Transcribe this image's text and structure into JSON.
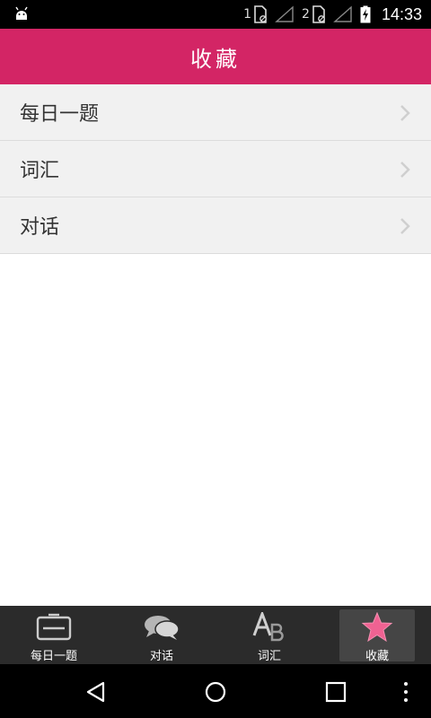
{
  "status_bar": {
    "sim1": "1",
    "sim2": "2",
    "time": "14:33"
  },
  "header": {
    "title": "收藏"
  },
  "favorites": [
    {
      "label": "每日一题"
    },
    {
      "label": "词汇"
    },
    {
      "label": "对话"
    }
  ],
  "tabs": [
    {
      "label": "每日一题",
      "icon": "daily-card-icon",
      "active": false
    },
    {
      "label": "对话",
      "icon": "chat-bubbles-icon",
      "active": false
    },
    {
      "label": "词汇",
      "icon": "ab-letters-icon",
      "active": false
    },
    {
      "label": "收藏",
      "icon": "star-icon",
      "active": true
    }
  ],
  "colors": {
    "accent": "#d32565",
    "list_bg": "#f1f1f1",
    "tab_bar_bg": "#2b2b2b",
    "star": "#f06292"
  }
}
